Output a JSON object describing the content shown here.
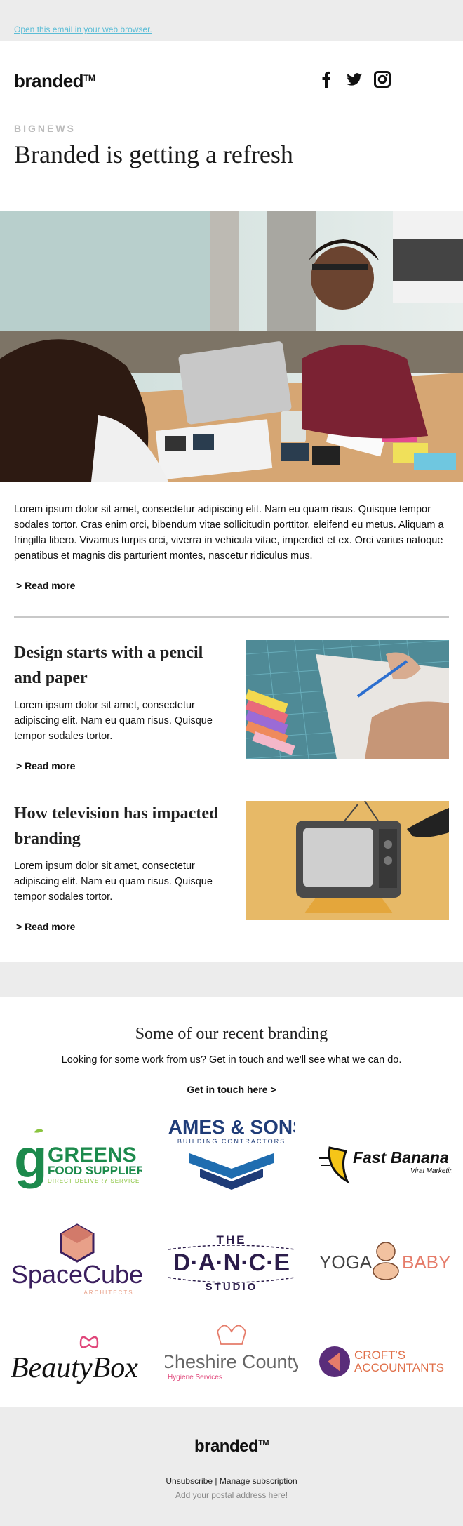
{
  "preheader": {
    "link_text": "Open this email in your web browser."
  },
  "header": {
    "logo": "branded",
    "logo_tm": "TM"
  },
  "lead": {
    "kicker": "BIGNEWS",
    "title": "Branded is getting a refresh",
    "body": "Lorem ipsum dolor sit amet, consectetur adipiscing elit. Nam eu quam risus. Quisque tempor sodales tortor. Cras enim orci, bibendum vitae sollicitudin porttitor, eleifend eu metus. Aliquam a fringilla libero. Vivamus turpis orci, viverra in vehicula vitae, imperdiet et ex. Orci varius natoque penatibus et magnis dis parturient montes, nascetur ridiculus mus.",
    "read_more": "> Read more"
  },
  "articles": [
    {
      "title": "Design starts with a pencil and paper",
      "body": "Lorem ipsum dolor sit amet, consectetur adipiscing elit. Nam eu quam risus. Quisque tempor sodales tortor.",
      "read_more": "> Read more"
    },
    {
      "title": "How television has impacted branding",
      "body": "Lorem ipsum dolor sit amet, consectetur adipiscing elit. Nam eu quam risus. Quisque tempor sodales tortor.",
      "read_more": "> Read more"
    }
  ],
  "branding": {
    "title": "Some of our recent branding",
    "subtitle": "Looking for some work from us? Get in touch and we'll see what we can do.",
    "cta": "Get in touch here >",
    "logos": [
      {
        "name": "GREENS",
        "line2": "FOOD SUPPLIERS",
        "line3": "DIRECT DELIVERY SERVICE",
        "letter": "g"
      },
      {
        "name": "JAMES & SONS",
        "line2": "BUILDING CONTRACTORS"
      },
      {
        "name": "Fast Banana",
        "line2": "Viral Marketing"
      },
      {
        "name": "SpaceCube",
        "line2": "ARCHITECTS"
      },
      {
        "name_top": "THE",
        "name": "D·A·N·C·E",
        "line2": "STUDIO"
      },
      {
        "name_left": "YOGA",
        "name_right": "BABY"
      },
      {
        "name": "BeautyBox"
      },
      {
        "name": "Cheshire County",
        "line2": "Hygiene Services"
      },
      {
        "name": "CROFT'S",
        "line2": "ACCOUNTANTS"
      }
    ]
  },
  "footer": {
    "logo": "branded",
    "logo_tm": "TM",
    "unsubscribe": "Unsubscribe",
    "separator": "|",
    "manage": "Manage subscription",
    "address": "Add your postal address here!"
  },
  "colors": {
    "link": "#5bbdd6",
    "background": "#ececec",
    "greens": "#1c8a4c",
    "james": "#1f3c78",
    "spacecube": "#3b1f5e",
    "beautybox_bow": "#e0467a",
    "crofts": "#e0704a"
  }
}
